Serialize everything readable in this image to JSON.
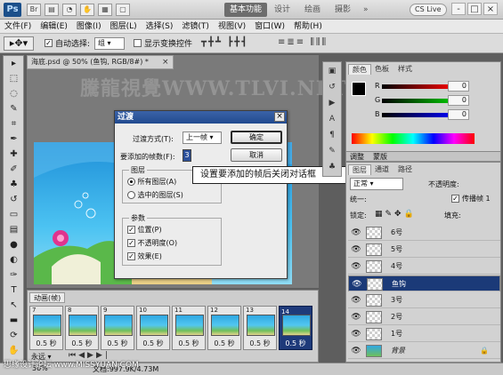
{
  "titlebar": {
    "app_logo": "Ps",
    "workspace_active": "基本功能",
    "workspaces": [
      "设计",
      "绘画",
      "摄影"
    ],
    "more": "»",
    "cslive": "CS Live",
    "win_min": "-",
    "win_max": "□",
    "win_close": "×"
  },
  "menubar": [
    "文件(F)",
    "编辑(E)",
    "图像(I)",
    "图层(L)",
    "选择(S)",
    "滤镜(T)",
    "视图(V)",
    "窗口(W)",
    "帮助(H)"
  ],
  "options": {
    "auto_select_label": "自动选择:",
    "auto_select_value": "组",
    "show_transform_label": "显示变换控件"
  },
  "document": {
    "tab_title": "海底.psd @ 50% (鱼钩, RGB/8#) *",
    "watermark": "騰龍視覺WWW.TLVI.NET"
  },
  "dialog": {
    "title": "过渡",
    "method_label": "过渡方式(T):",
    "method_value": "上一帧",
    "frames_label": "要添加的帧数(F):",
    "frames_value": "3",
    "ok": "确定",
    "cancel": "取消",
    "layers_group": "图层",
    "all_layers": "所有图层(A)",
    "selected_layers": "选中的图层(S)",
    "params_group": "参数",
    "position": "位置(P)",
    "opacity": "不透明度(O)",
    "effects": "效果(E)"
  },
  "callout": "设置要添加的帧后关闭对话框",
  "animation": {
    "tab": "动画(帧)",
    "frames": [
      {
        "num": "7",
        "dur": "0.5 秒"
      },
      {
        "num": "8",
        "dur": "0.5 秒"
      },
      {
        "num": "9",
        "dur": "0.5 秒"
      },
      {
        "num": "10",
        "dur": "0.5 秒"
      },
      {
        "num": "11",
        "dur": "0.5 秒"
      },
      {
        "num": "12",
        "dur": "0.5 秒"
      },
      {
        "num": "13",
        "dur": "0.5 秒"
      },
      {
        "num": "14",
        "dur": "0.5 秒"
      }
    ],
    "loop": "永远"
  },
  "color_panel": {
    "tabs": [
      "颜色",
      "色板",
      "样式"
    ],
    "r": "0",
    "g": "0",
    "b": "0",
    "r_label": "R",
    "g_label": "G",
    "b_label": "B"
  },
  "layers_panel": {
    "tabs": [
      "图层",
      "通道",
      "路径"
    ],
    "blend": "正常",
    "opacity_label": "不透明度:",
    "unify_label": "统一:",
    "propagate_label": "传播帧 1",
    "lock_label": "锁定:",
    "fill_label": "填充:",
    "layers": [
      "6号",
      "5号",
      "4号",
      "鱼钩",
      "3号",
      "2号",
      "1号",
      "背景"
    ]
  },
  "adjust_tabs": [
    "调整",
    "蒙版"
  ],
  "status": {
    "zoom": "50%",
    "doc": "文档:997.9K/4.73M",
    "watermark": "思缘设计论坛 www.MISSYUAN.COM"
  },
  "colors": {
    "accent": "#1e3a7a",
    "dialog_title": "#214a8f"
  }
}
